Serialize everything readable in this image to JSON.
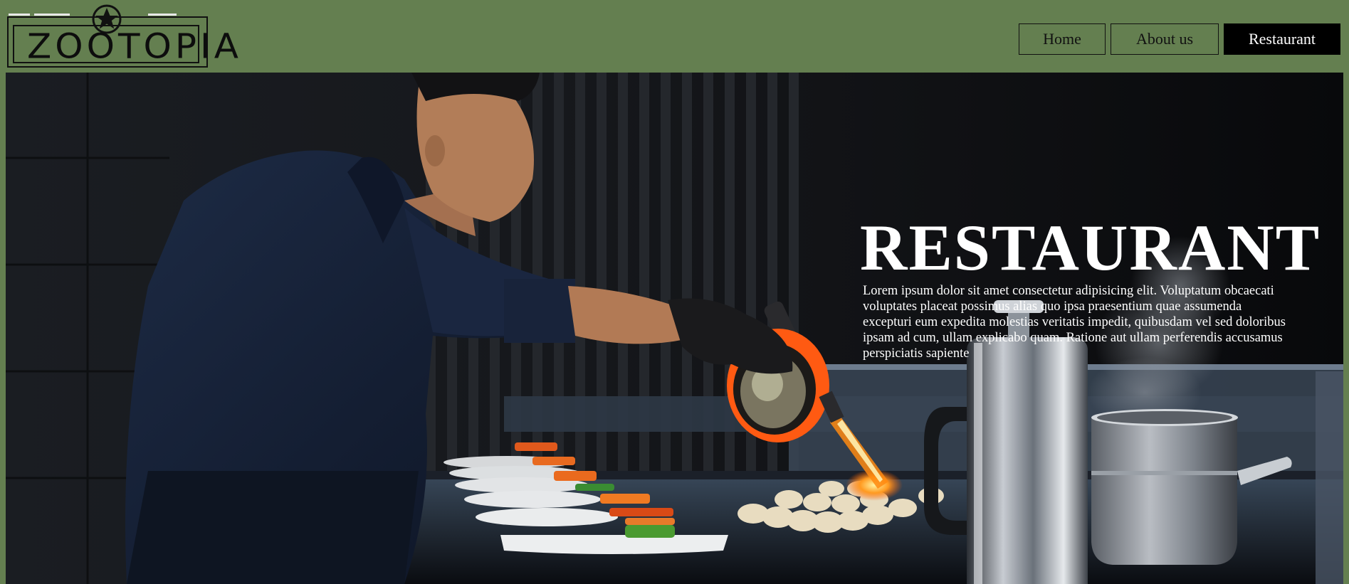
{
  "header": {
    "logo_text": "ZOOTOPIA",
    "nav": [
      {
        "label": "Home"
      },
      {
        "label": "About us"
      },
      {
        "label": "Restaurant"
      }
    ]
  },
  "hero": {
    "title": "RESTAURANT",
    "description": "Lorem ipsum dolor sit amet consectetur adipisicing elit. Voluptatum obcaecati voluptates placeat possimus alias quo ipsa praesentium quae assumenda excepturi eum expedita molestias veritatis impedit, quibusdam vel sed doloribus ipsam ad cum, ullam explicabo quam. Ratione aut ullam perferendis accusamus perspiciatis sapiente"
  },
  "colors": {
    "header_bg": "#647f50",
    "active_nav_bg": "#000000",
    "hero_text": "#ffffff"
  }
}
